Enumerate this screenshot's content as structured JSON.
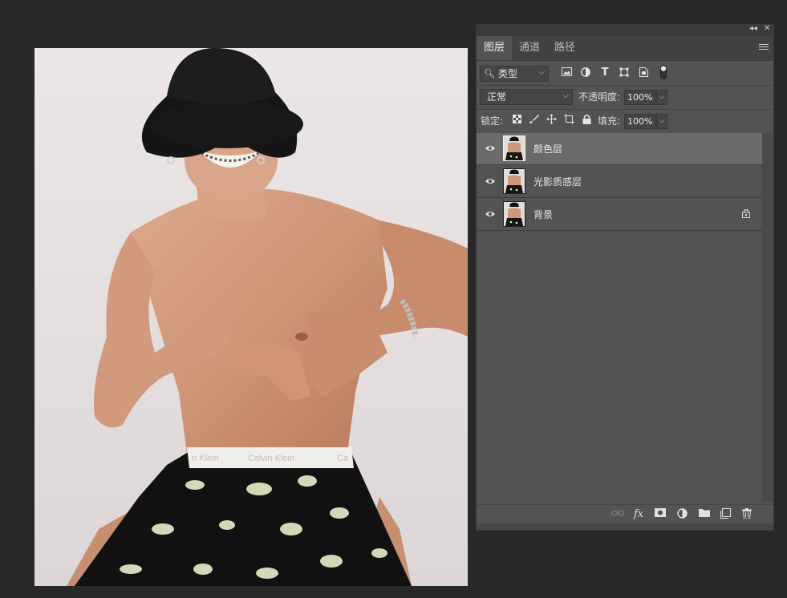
{
  "panel": {
    "collapse_icon": "double-chevron-left-icon",
    "close_icon": "close-icon",
    "tabs": [
      {
        "label": "图层",
        "active": true
      },
      {
        "label": "通道",
        "active": false
      },
      {
        "label": "路径",
        "active": false
      }
    ],
    "menu_icon": "hamburger-menu-icon"
  },
  "filter": {
    "kind_label": "类型",
    "icons": [
      "image-filter-icon",
      "adjustment-filter-icon",
      "text-filter-icon",
      "shape-filter-icon",
      "smart-object-filter-icon",
      "filter-toggle-icon"
    ]
  },
  "blend": {
    "mode": "正常",
    "opacity_label": "不透明度:",
    "opacity_value": "100%"
  },
  "lock": {
    "label": "锁定:",
    "icons": [
      "lock-transparent-icon",
      "lock-paint-icon",
      "lock-position-icon",
      "lock-artboard-icon",
      "lock-all-icon"
    ],
    "fill_label": "填充:",
    "fill_value": "100%"
  },
  "layers": [
    {
      "name": "颜色层",
      "visible": true,
      "selected": true,
      "locked": false
    },
    {
      "name": "光影质感层",
      "visible": true,
      "selected": false,
      "locked": false
    },
    {
      "name": "背景",
      "visible": true,
      "selected": false,
      "locked": true
    }
  ],
  "footer_icons": [
    "link-layers-icon",
    "fx-icon",
    "add-mask-icon",
    "adjustment-layer-icon",
    "new-group-icon",
    "new-layer-icon",
    "delete-layer-icon"
  ],
  "footer": {
    "fx_label": "fx"
  },
  "document": {
    "waistband_text": "Calvin Klein",
    "waistband_text_left": "n Klein",
    "waistband_text_right": "Ca"
  },
  "colors": {
    "workspace": "#282828",
    "panel": "#535353",
    "selected_layer": "#6a6a6a"
  }
}
